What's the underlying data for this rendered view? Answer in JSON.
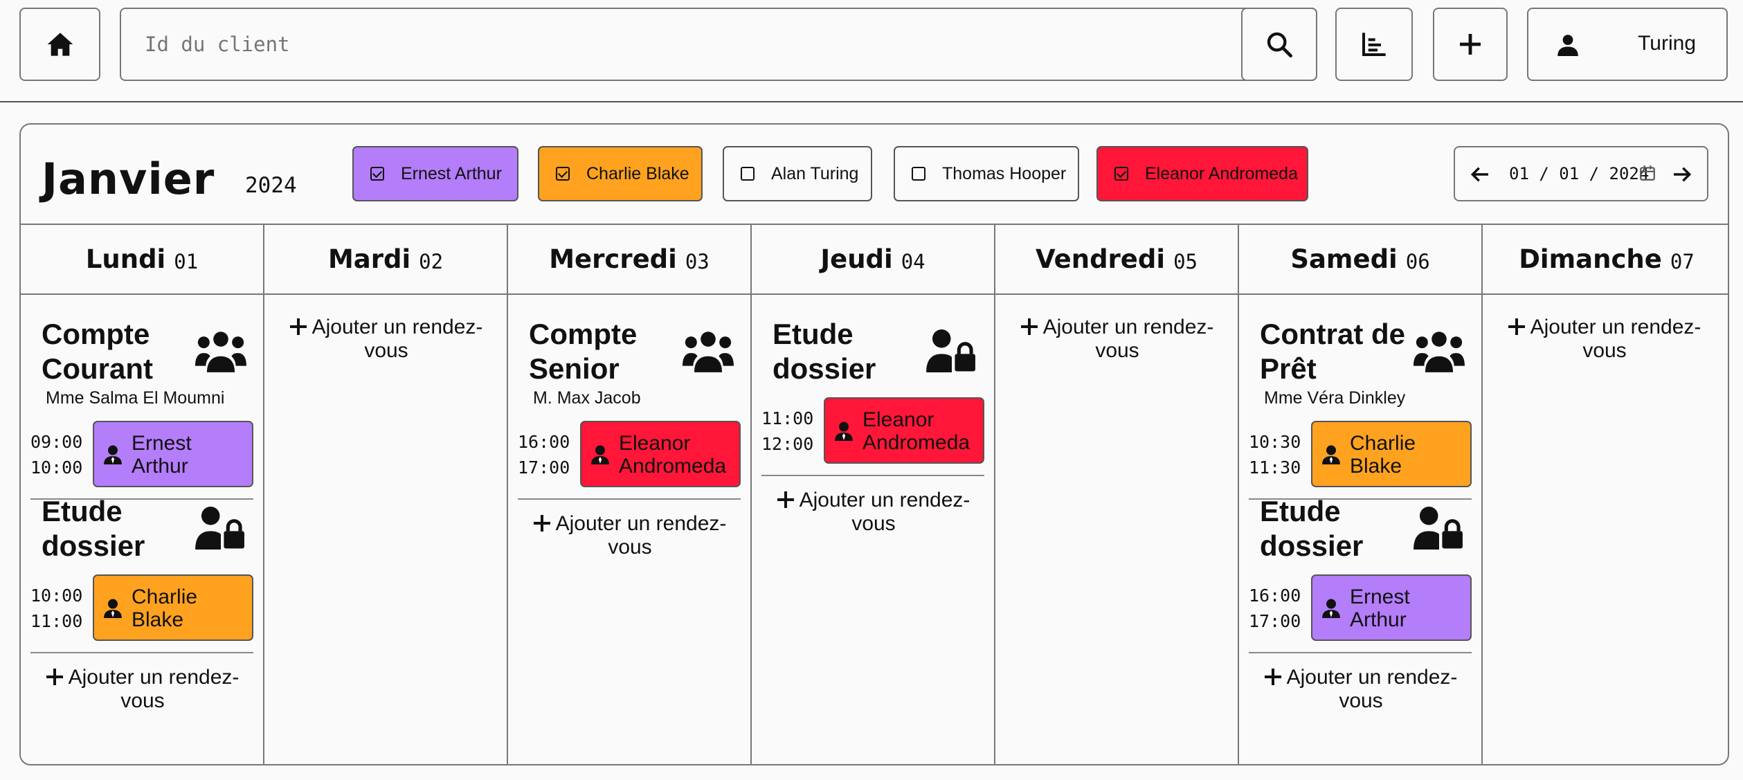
{
  "header": {
    "search_placeholder": "Id du client",
    "user_name": "Turing"
  },
  "calendar": {
    "month": "Janvier",
    "year": "2024",
    "date_value": "01 / 01 / 2024",
    "add_label_1": "Ajouter un rendez-",
    "add_label_2": "vous",
    "colors": {
      "purple": "#b47dfa",
      "orange": "#ffa21f",
      "red": "#ff1638"
    },
    "filters": [
      {
        "label": "Ernest Arthur",
        "checked": true,
        "color": "#b47dfa"
      },
      {
        "label": "Charlie Blake",
        "checked": true,
        "color": "#ffa21f"
      },
      {
        "label": "Alan Turing",
        "checked": false,
        "color": ""
      },
      {
        "label": "Thomas Hooper",
        "checked": false,
        "color": ""
      },
      {
        "label": "Eleanor Andromeda",
        "checked": true,
        "color": "#ff1638"
      }
    ],
    "days": [
      {
        "name": "Lundi",
        "num": "01",
        "appointments": [
          {
            "title_1": "Compte",
            "title_2": "Courant",
            "icon": "group-icon",
            "client": "Mme Salma El Moumni",
            "start": "09:00",
            "end": "10:00",
            "advisor_1": "Ernest",
            "advisor_2": "Arthur",
            "color": "purple"
          },
          {
            "title_1": "Etude",
            "title_2": "dossier",
            "icon": "user-lock-icon",
            "client": "",
            "start": "10:00",
            "end": "11:00",
            "advisor_1": "Charlie",
            "advisor_2": "Blake",
            "color": "orange"
          }
        ]
      },
      {
        "name": "Mardi",
        "num": "02",
        "appointments": []
      },
      {
        "name": "Mercredi",
        "num": "03",
        "appointments": [
          {
            "title_1": "Compte",
            "title_2": "Senior",
            "icon": "group-icon",
            "client": "M. Max Jacob",
            "start": "16:00",
            "end": "17:00",
            "advisor_1": "Eleanor",
            "advisor_2": "Andromeda",
            "color": "red"
          }
        ]
      },
      {
        "name": "Jeudi",
        "num": "04",
        "appointments": [
          {
            "title_1": "Etude",
            "title_2": "dossier",
            "icon": "user-lock-icon",
            "client": "",
            "start": "11:00",
            "end": "12:00",
            "advisor_1": "Eleanor",
            "advisor_2": "Andromeda",
            "color": "red"
          }
        ]
      },
      {
        "name": "Vendredi",
        "num": "05",
        "appointments": []
      },
      {
        "name": "Samedi",
        "num": "06",
        "appointments": [
          {
            "title_1": "Contrat de",
            "title_2": "Prêt",
            "icon": "group-icon",
            "client": "Mme Véra Dinkley",
            "start": "10:30",
            "end": "11:30",
            "advisor_1": "Charlie",
            "advisor_2": "Blake",
            "color": "orange"
          },
          {
            "title_1": "Etude",
            "title_2": "dossier",
            "icon": "user-lock-icon",
            "client": "",
            "start": "16:00",
            "end": "17:00",
            "advisor_1": "Ernest",
            "advisor_2": "Arthur",
            "color": "purple"
          }
        ]
      },
      {
        "name": "Dimanche",
        "num": "07",
        "appointments": []
      }
    ]
  }
}
